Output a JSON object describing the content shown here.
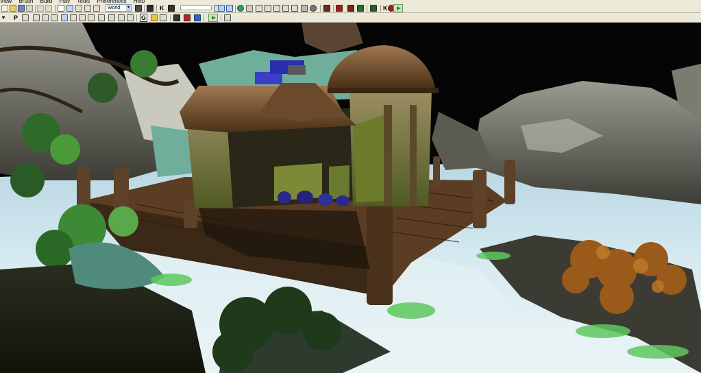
{
  "menu": [
    "View",
    "Brush",
    "Build",
    "Play",
    "Tools",
    "Preferences",
    "Help"
  ],
  "toolbar": {
    "coordinate_system": "World",
    "k_label": "K",
    "p_label": "P",
    "g_label": "G",
    "play_label": "Play level"
  },
  "icons": {
    "new": "new-map-icon",
    "open": "open-icon",
    "save": "save-icon",
    "undo": "undo-icon",
    "redo": "redo-icon",
    "select": "select-cursor-icon",
    "translate": "translate-icon",
    "rotate": "rotate-icon",
    "scale": "scale-icon",
    "find": "binoculars-icon",
    "sphere": "sphere-icon",
    "cube": "cube-icon"
  },
  "colors": {
    "chrome": "#ece9d8",
    "water": "#cfe3ea",
    "play": "#1f9a1f"
  }
}
